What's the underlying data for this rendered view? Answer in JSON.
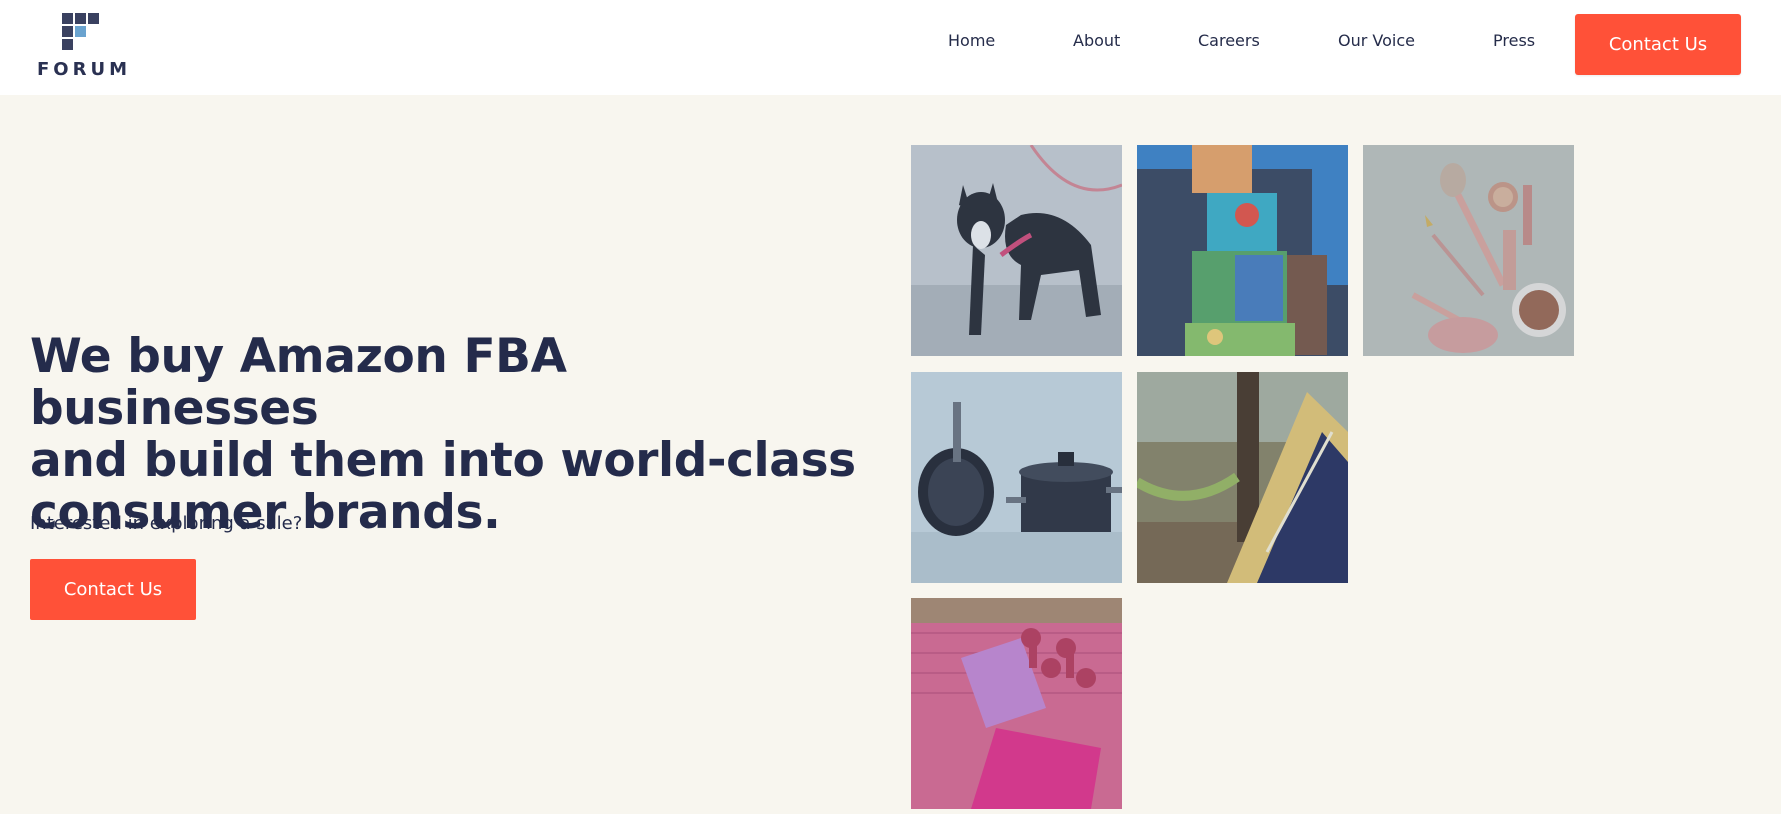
{
  "brand": {
    "name": "FORUM",
    "colors": {
      "accent": "#ff5138",
      "navy": "#242b4b",
      "background": "#f8f6ef",
      "logo_light": "#6aa3cf"
    }
  },
  "nav": {
    "items": [
      {
        "label": "Home"
      },
      {
        "label": "About"
      },
      {
        "label": "Careers"
      },
      {
        "label": "Our Voice"
      },
      {
        "label": "Press"
      }
    ],
    "cta_label": "Contact Us"
  },
  "hero": {
    "headline_lines": [
      "We buy Amazon FBA businesses",
      "and build them into world-class",
      "consumer brands."
    ],
    "subtext": "Interested in exploring a sale?",
    "cta_label": "Contact Us"
  },
  "gallery": {
    "tiles": [
      {
        "subject": "dog-on-leash-photo"
      },
      {
        "subject": "stacked-toy-blocks-photo"
      },
      {
        "subject": "makeup-cosmetics-photo"
      },
      {
        "subject": "cookware-pots-pans-photo"
      },
      {
        "subject": "camping-tent-hammock-photo"
      },
      {
        "subject": "yoga-mat-dumbbells-photo"
      }
    ]
  }
}
